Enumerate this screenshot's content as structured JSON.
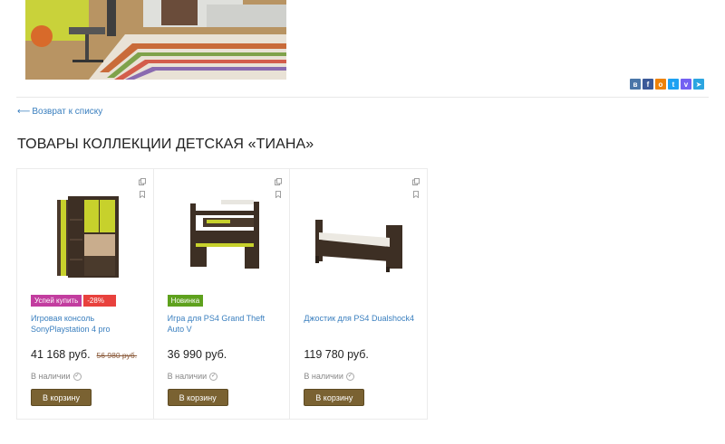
{
  "share": {
    "items": [
      {
        "name": "vk-share-icon",
        "glyph": "в",
        "color": "#4a76a8"
      },
      {
        "name": "facebook-share-icon",
        "glyph": "f",
        "color": "#3b5998"
      },
      {
        "name": "odnoklassniki-share-icon",
        "glyph": "о",
        "color": "#ee8208"
      },
      {
        "name": "twitter-share-icon",
        "glyph": "t",
        "color": "#1da1f2"
      },
      {
        "name": "viber-share-icon",
        "glyph": "v",
        "color": "#7360f2"
      },
      {
        "name": "telegram-share-icon",
        "glyph": "➤",
        "color": "#2ca5e0"
      }
    ]
  },
  "nav": {
    "back_label": "Возврат к списку",
    "back_arrow": "⟵"
  },
  "section": {
    "title": "ТОВАРЫ КОЛЛЕКЦИИ ДЕТСКАЯ «ТИАНА»"
  },
  "products": [
    {
      "title": "Игровая консоль SonyPlaystation 4 pro",
      "price": "41 168 руб.",
      "old_price": "56 980 руб.",
      "availability": "В наличии",
      "button": "В корзину",
      "badges": [
        {
          "label": "Успей купить",
          "color": "#c23d9f"
        },
        {
          "label": "-28%",
          "color": "#e8413d"
        }
      ],
      "image_icon": "wardrobe-image"
    },
    {
      "title": "Игра для PS4 Grand Theft Auto V",
      "price": "36 990 руб.",
      "old_price": "",
      "availability": "В наличии",
      "button": "В корзину",
      "badges": [
        {
          "label": "Новинка",
          "color": "#5ea11d"
        }
      ],
      "image_icon": "loft-bed-image"
    },
    {
      "title": "Джостик для PS4 Dualshock4",
      "price": "119 780 руб.",
      "old_price": "",
      "availability": "В наличии",
      "button": "В корзину",
      "badges": [],
      "image_icon": "bed-image"
    }
  ]
}
